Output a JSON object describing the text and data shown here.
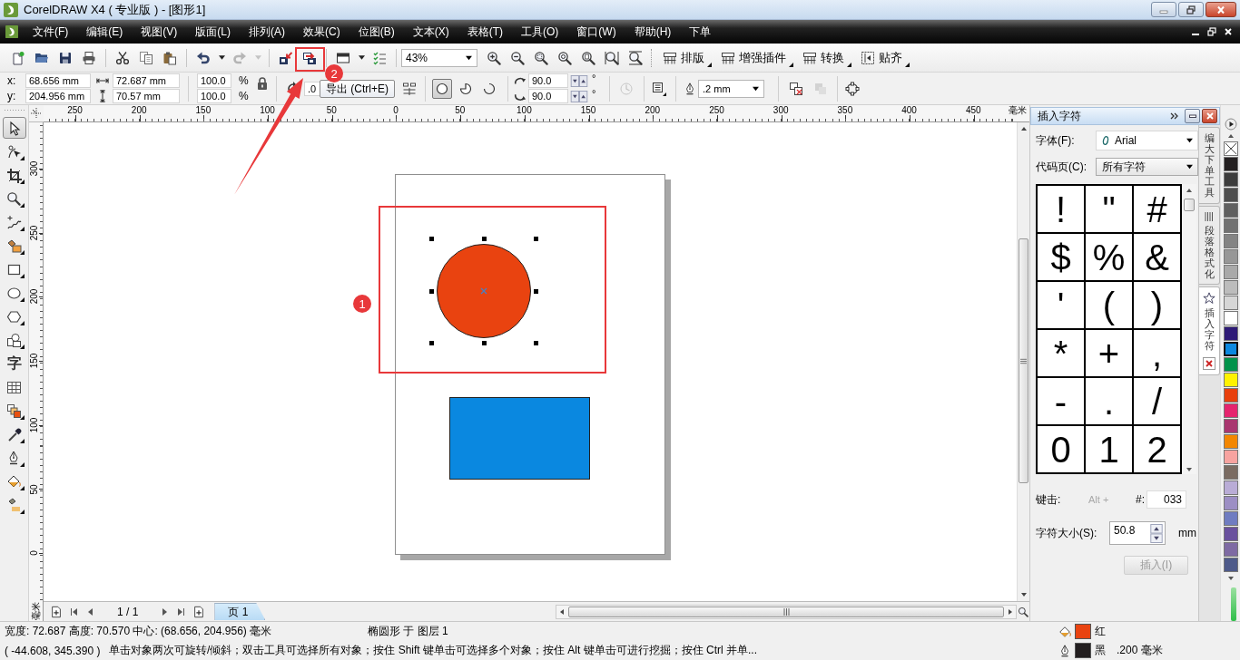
{
  "window": {
    "title": "CorelDRAW X4 ( 专业版 ) - [图形1]"
  },
  "menu": [
    "文件(F)",
    "编辑(E)",
    "视图(V)",
    "版面(L)",
    "排列(A)",
    "效果(C)",
    "位图(B)",
    "文本(X)",
    "表格(T)",
    "工具(O)",
    "窗口(W)",
    "帮助(H)",
    "下单"
  ],
  "toolbar": {
    "groups": [
      [
        {
          "kind": "new",
          "disabled": false
        },
        {
          "kind": "open",
          "disabled": false
        },
        {
          "kind": "save",
          "disabled": false
        },
        {
          "kind": "print",
          "disabled": false
        }
      ],
      [
        {
          "kind": "cut",
          "disabled": false
        },
        {
          "kind": "copy",
          "disabled": false
        },
        {
          "kind": "paste",
          "disabled": false
        }
      ],
      [
        {
          "kind": "undo",
          "disabled": false
        },
        {
          "kind": "caret",
          "disabled": false
        },
        {
          "kind": "redo",
          "disabled": true
        },
        {
          "kind": "caret",
          "disabled": true
        }
      ],
      [
        {
          "kind": "import",
          "disabled": false
        },
        {
          "kind": "export",
          "disabled": false
        }
      ],
      [
        {
          "kind": "launcher",
          "disabled": false
        },
        {
          "kind": "caret",
          "disabled": false
        },
        {
          "kind": "options",
          "disabled": false
        }
      ]
    ],
    "zoom": "43%",
    "zoom_tools": [
      {
        "kind": "zoom_in"
      },
      {
        "kind": "zoom_out"
      },
      {
        "kind": "zoom_selected"
      },
      {
        "kind": "zoom_all"
      },
      {
        "kind": "zoom_page"
      },
      {
        "kind": "zoom_width"
      },
      {
        "kind": "zoom_height"
      }
    ],
    "plugins": [
      {
        "kind": "grid",
        "label": "排版"
      },
      {
        "kind": "grid",
        "label": "增强插件"
      },
      {
        "kind": "grid",
        "label": "转换"
      },
      {
        "kind": "snap",
        "label": "贴齐"
      }
    ]
  },
  "properties": {
    "position": [
      {
        "label": "x:",
        "value": "68.656 mm"
      },
      {
        "label": "y:",
        "value": "204.956 mm"
      }
    ],
    "size": [
      {
        "kind": "width",
        "value": "72.687 mm"
      },
      {
        "kind": "height",
        "value": "70.57 mm"
      }
    ],
    "scale": [
      {
        "value": "100.0",
        "unit": "%"
      },
      {
        "value": "100.0",
        "unit": "%"
      }
    ],
    "rotation": ".0",
    "ellipse_modes": [
      {
        "kind": "ellipse",
        "selected": true
      },
      {
        "kind": "pie",
        "selected": false
      },
      {
        "kind": "arc",
        "selected": false
      }
    ],
    "angles": [
      {
        "kind": "start",
        "value": "90.0",
        "unit": "°"
      },
      {
        "kind": "end",
        "value": "90.0",
        "unit": "°"
      }
    ],
    "direction": {
      "disabled": true
    },
    "outline_width": ".2 mm",
    "order_tools": [
      {
        "kind": "overlap_remove",
        "disabled": false
      },
      {
        "kind": "overlap",
        "disabled": true
      }
    ],
    "tooltip": "导出 (Ctrl+E)"
  },
  "rulers": {
    "horizontal": [
      "250",
      "200",
      "150",
      "100",
      "50",
      "0",
      "50",
      "100",
      "150",
      "200",
      "250",
      "300",
      "350",
      "400",
      "450"
    ],
    "horizontal_unit": "毫米",
    "vertical": [
      "300",
      "250",
      "200",
      "150",
      "100",
      "50",
      "0"
    ],
    "vertical_unit": "毫米"
  },
  "toolbox": [
    {
      "kind": "pick",
      "flyout": false,
      "selected": true
    },
    {
      "kind": "shape",
      "flyout": true,
      "selected": false
    },
    {
      "kind": "crop",
      "flyout": true,
      "selected": false
    },
    {
      "kind": "zoom",
      "flyout": true,
      "selected": false
    },
    {
      "kind": "freehand",
      "flyout": true,
      "selected": false
    },
    {
      "kind": "smart_fill",
      "flyout": true,
      "selected": false
    },
    {
      "kind": "rectangle",
      "flyout": true,
      "selected": false
    },
    {
      "kind": "ellipse",
      "flyout": true,
      "selected": false
    },
    {
      "kind": "polygon",
      "flyout": true,
      "selected": false
    },
    {
      "kind": "basic_shapes",
      "flyout": true,
      "selected": false
    },
    {
      "kind": "text",
      "label": "字",
      "flyout": false,
      "selected": false
    },
    {
      "kind": "table",
      "flyout": false,
      "selected": false
    },
    {
      "kind": "blend",
      "flyout": true,
      "selected": false
    },
    {
      "kind": "eyedropper",
      "flyout": true,
      "selected": false
    },
    {
      "kind": "outline",
      "flyout": true,
      "selected": false
    },
    {
      "kind": "fill",
      "flyout": true,
      "selected": false
    },
    {
      "kind": "interactive_fill",
      "flyout": true,
      "selected": false
    }
  ],
  "document": {
    "objects": [
      {
        "kind": "ellipse",
        "color": "#e94310",
        "selected": true
      },
      {
        "kind": "rectangle",
        "color": "#0a88e0",
        "selected": false
      }
    ]
  },
  "annotations": {
    "badges": [
      "1",
      "2"
    ]
  },
  "page_nav": {
    "counter": "1 / 1",
    "tabs": [
      {
        "label": "页 1",
        "selected": true
      }
    ]
  },
  "docker": {
    "title": "插入字符",
    "font": {
      "label": "字体(F):",
      "value": "Arial"
    },
    "code_page": {
      "label": "代码页(C):",
      "value": "所有字符"
    },
    "characters": [
      "!",
      "\"",
      "#",
      "$",
      "%",
      "&",
      "'",
      "(",
      ")",
      "*",
      "+",
      ",",
      "-",
      ".",
      "/",
      "0",
      "1",
      "2"
    ],
    "keystroke": {
      "label": "键击:",
      "prefix": "Alt +",
      "code_label": "#:",
      "code": "033"
    },
    "char_size": {
      "label": "字符大小(S):",
      "value": "50.8",
      "unit": "mm"
    },
    "insert": {
      "label": "插入(I)",
      "disabled": true
    }
  },
  "docker_tabs": [
    {
      "kind": "plain",
      "label": "编大下单工具",
      "selected": false
    },
    {
      "kind": "paragraph",
      "label": "段落格式化",
      "selected": false
    },
    {
      "kind": "glyph",
      "label": "插入字符",
      "selected": true
    }
  ],
  "palette": [
    {
      "kind": "none",
      "selected": false
    },
    {
      "kind": "color",
      "color": "#231f20",
      "selected": false
    },
    {
      "kind": "color",
      "color": "#3c3c3c",
      "selected": false
    },
    {
      "kind": "color",
      "color": "#4e4e4e",
      "selected": false
    },
    {
      "kind": "color",
      "color": "#606060",
      "selected": false
    },
    {
      "kind": "color",
      "color": "#717171",
      "selected": false
    },
    {
      "kind": "color",
      "color": "#848484",
      "selected": false
    },
    {
      "kind": "color",
      "color": "#979797",
      "selected": false
    },
    {
      "kind": "color",
      "color": "#a9a9a9",
      "selected": false
    },
    {
      "kind": "color",
      "color": "#bcbcbc",
      "selected": false
    },
    {
      "kind": "color",
      "color": "#d6d6d6",
      "selected": false
    },
    {
      "kind": "color",
      "color": "#ffffff",
      "selected": false
    },
    {
      "kind": "color",
      "color": "#2e1a77",
      "selected": false
    },
    {
      "kind": "color",
      "color": "#0b88df",
      "selected": true
    },
    {
      "kind": "color",
      "color": "#00924a",
      "selected": false
    },
    {
      "kind": "color",
      "color": "#fff200",
      "selected": false
    },
    {
      "kind": "color",
      "color": "#e83f0c",
      "selected": false
    },
    {
      "kind": "color",
      "color": "#e5246e",
      "selected": false
    },
    {
      "kind": "color",
      "color": "#a9366f",
      "selected": false
    },
    {
      "kind": "color",
      "color": "#f38600",
      "selected": false
    },
    {
      "kind": "color",
      "color": "#f7a3a0",
      "selected": false
    },
    {
      "kind": "color",
      "color": "#7a6b62",
      "selected": false
    },
    {
      "kind": "color",
      "color": "#b9acd6",
      "selected": false
    },
    {
      "kind": "color",
      "color": "#9c8ec4",
      "selected": false
    },
    {
      "kind": "color",
      "color": "#6f7cc1",
      "selected": false
    },
    {
      "kind": "color",
      "color": "#69509e",
      "selected": false
    },
    {
      "kind": "color",
      "color": "#7e6aa3",
      "selected": false
    },
    {
      "kind": "color",
      "color": "#4e5a8a",
      "selected": false
    }
  ],
  "status": {
    "dimensions": "宽度: 72.687 高度: 70.570 中心: (68.656, 204.956) 毫米",
    "object": "椭圆形 于 图层 1",
    "cursor": "( -44.608, 345.390 )",
    "hint": "单击对象两次可旋转/倾斜；双击工具可选择所有对象；按住 Shift 键单击可选择多个对象；按住 Alt 键单击可进行挖掘；按住 Ctrl 并单...",
    "fill": {
      "color": "#e94310",
      "name": "红"
    },
    "outline": {
      "color": "#231f20",
      "name": "黑",
      "width": ".200 毫米"
    }
  }
}
